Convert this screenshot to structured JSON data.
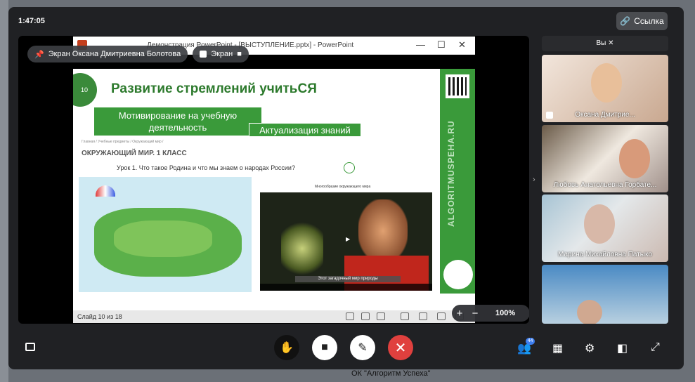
{
  "window": {
    "timer": "1:47:05",
    "link_label": "Ссылка"
  },
  "stage": {
    "pill_screen_owner": "Экран Оксана Дмитриевна Болотова",
    "pill_screen": "Экран",
    "zoom": "100%"
  },
  "ppt": {
    "window_title": "Демонстрация PowerPoint - [ВЫСТУПЛЕНИЕ.pptx] - PowerPoint",
    "status": "Слайд 10 из 18",
    "slide": {
      "number": "10",
      "title": "Развитие стремлений учитьСЯ",
      "tag1": "Мотивирование на учебную деятельность",
      "tag2": "Актуализация знаний",
      "breadcrumb": "Главная / Учебные предметы / Окружающий мир /",
      "section": "ОКРУЖАЮЩИЙ МИР. 1 КЛАСС",
      "lesson": "Урок 1. Что такое Родина и что мы знаем о народах России?",
      "brand_vertical": "ALGORITMUSPEHA.RU",
      "video_caption": "Многообразие окружающего мира",
      "video_subtitle": "Этот загадочный мир природы"
    }
  },
  "participants": {
    "self_label": "Вы",
    "tiles": [
      {
        "name": "Оксана Дмитрие..."
      },
      {
        "name": "Любовь Анатольевна Горбате..."
      },
      {
        "name": "Марина Михайловна Патыко"
      },
      {
        "name": ""
      }
    ],
    "count_badge": "44"
  },
  "background": {
    "bottom_text": "ОК \"Алгоритм Успеха\""
  }
}
